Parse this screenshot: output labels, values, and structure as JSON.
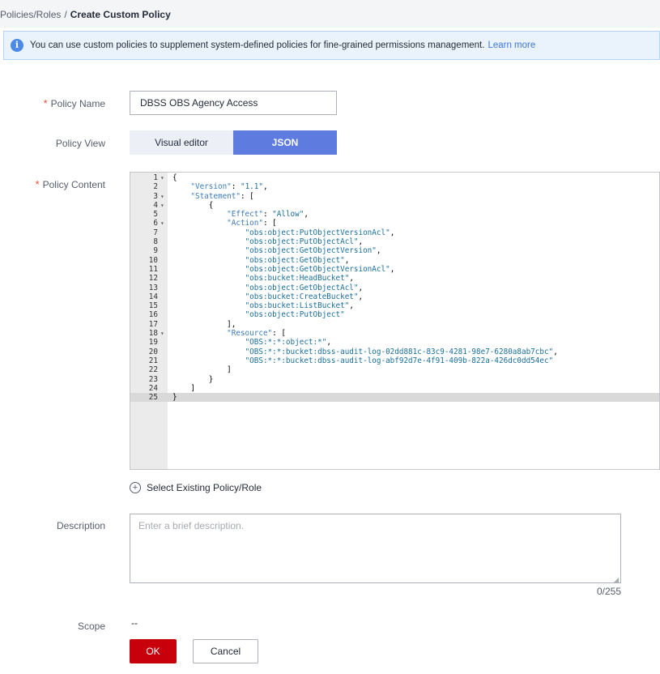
{
  "breadcrumb": {
    "parent": "Policies/Roles",
    "separator": "/",
    "current": "Create Custom Policy"
  },
  "alert": {
    "icon": "info-icon",
    "text": "You can use custom policies to supplement system-defined policies for fine-grained permissions management.",
    "link": "Learn more"
  },
  "form": {
    "policy_name": {
      "label": "Policy Name",
      "required_mark": "*",
      "value": "DBSS OBS Agency Access"
    },
    "policy_view": {
      "label": "Policy View",
      "options": [
        "Visual editor",
        "JSON"
      ],
      "selected": "JSON"
    },
    "policy_content": {
      "label": "Policy Content",
      "required_mark": "*",
      "lines": [
        "{",
        "    \"Version\": \"1.1\",",
        "    \"Statement\": [",
        "        {",
        "            \"Effect\": \"Allow\",",
        "            \"Action\": [",
        "                \"obs:object:PutObjectVersionAcl\",",
        "                \"obs:object:PutObjectAcl\",",
        "                \"obs:object:GetObjectVersion\",",
        "                \"obs:object:GetObject\",",
        "                \"obs:object:GetObjectVersionAcl\",",
        "                \"obs:bucket:HeadBucket\",",
        "                \"obs:object:GetObjectAcl\",",
        "                \"obs:bucket:CreateBucket\",",
        "                \"obs:bucket:ListBucket\",",
        "                \"obs:object:PutObject\"",
        "            ],",
        "            \"Resource\": [",
        "                \"OBS:*:*:object:*\",",
        "                \"OBS:*:*:bucket:dbss-audit-log-02dd881c-83c9-4281-98e7-6280a8ab7cbc\",",
        "                \"OBS:*:*:bucket:dbss-audit-log-abf92d7e-4f91-409b-822a-426dc0dd54ec\"",
        "            ]",
        "        }",
        "    ]",
        "}"
      ],
      "foldable_lines": [
        1,
        3,
        4,
        6,
        18
      ],
      "active_line": 25
    },
    "select_existing": {
      "icon": "plus-circle-icon",
      "label": "Select Existing Policy/Role"
    },
    "description": {
      "label": "Description",
      "placeholder": "Enter a brief description.",
      "value": "",
      "counter": "0/255"
    },
    "scope": {
      "label": "Scope",
      "value": "--"
    }
  },
  "actions": {
    "ok": "OK",
    "cancel": "Cancel"
  },
  "colors": {
    "primary": "#c7000b",
    "json_tab": "#5e7ce0",
    "link": "#3e77dd",
    "required": "#e94a3c"
  }
}
